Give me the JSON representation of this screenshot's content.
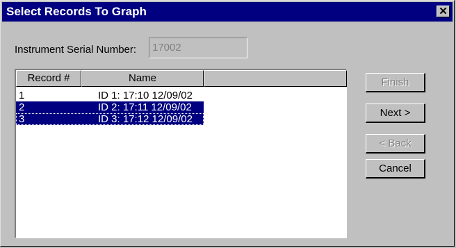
{
  "window": {
    "title": "Select Records To Graph",
    "close_glyph": "✕"
  },
  "serial": {
    "label": "Instrument Serial Number:",
    "value": "17002"
  },
  "list": {
    "columns": [
      "Record #",
      "Name",
      ""
    ],
    "rows": [
      {
        "record": "1",
        "name": "ID 1: 17:10 12/09/02",
        "selected": false
      },
      {
        "record": "2",
        "name": "ID 2: 17:11 12/09/02",
        "selected": true
      },
      {
        "record": "3",
        "name": "ID 3: 17:12 12/09/02",
        "selected": true
      }
    ]
  },
  "buttons": {
    "finish": "Finish",
    "next": "Next >",
    "back": "< Back",
    "cancel": "Cancel"
  },
  "colors": {
    "title_bar": "#000080",
    "selection": "#000080",
    "face": "#c0c0c0"
  }
}
